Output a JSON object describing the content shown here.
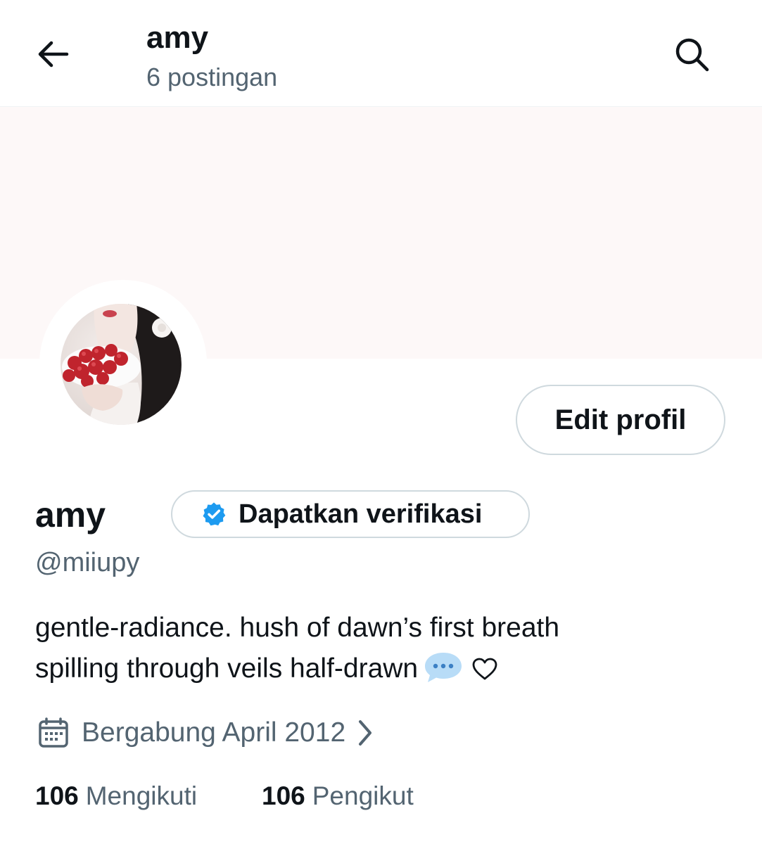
{
  "header": {
    "title": "amy",
    "post_count": "6 postingan"
  },
  "profile": {
    "display_name": "amy",
    "handle": "@miiupy",
    "edit_button_label": "Edit profil",
    "verify_button_label": "Dapatkan verifikasi",
    "bio_line_1": "gentle-radiance. hush of dawn’s first breath",
    "bio_line_2": "spilling through veils half-drawn",
    "joined_text": "Bergabung April 2012",
    "following_count": "106",
    "following_label": "Mengikuti",
    "followers_count": "106",
    "followers_label": "Pengikut"
  },
  "icons": {
    "back": "arrow-left-icon",
    "search": "search-icon",
    "verified": "verified-badge-icon",
    "speech_bubble": "speech-bubble-emoji",
    "heart": "heart-outline-icon",
    "calendar": "calendar-icon",
    "chevron": "chevron-right-icon"
  },
  "colors": {
    "text_primary": "#0f1419",
    "text_secondary": "#536471",
    "verified_blue": "#1d9bf0",
    "banner": "#fdf8f8",
    "border": "#cfd9de"
  }
}
